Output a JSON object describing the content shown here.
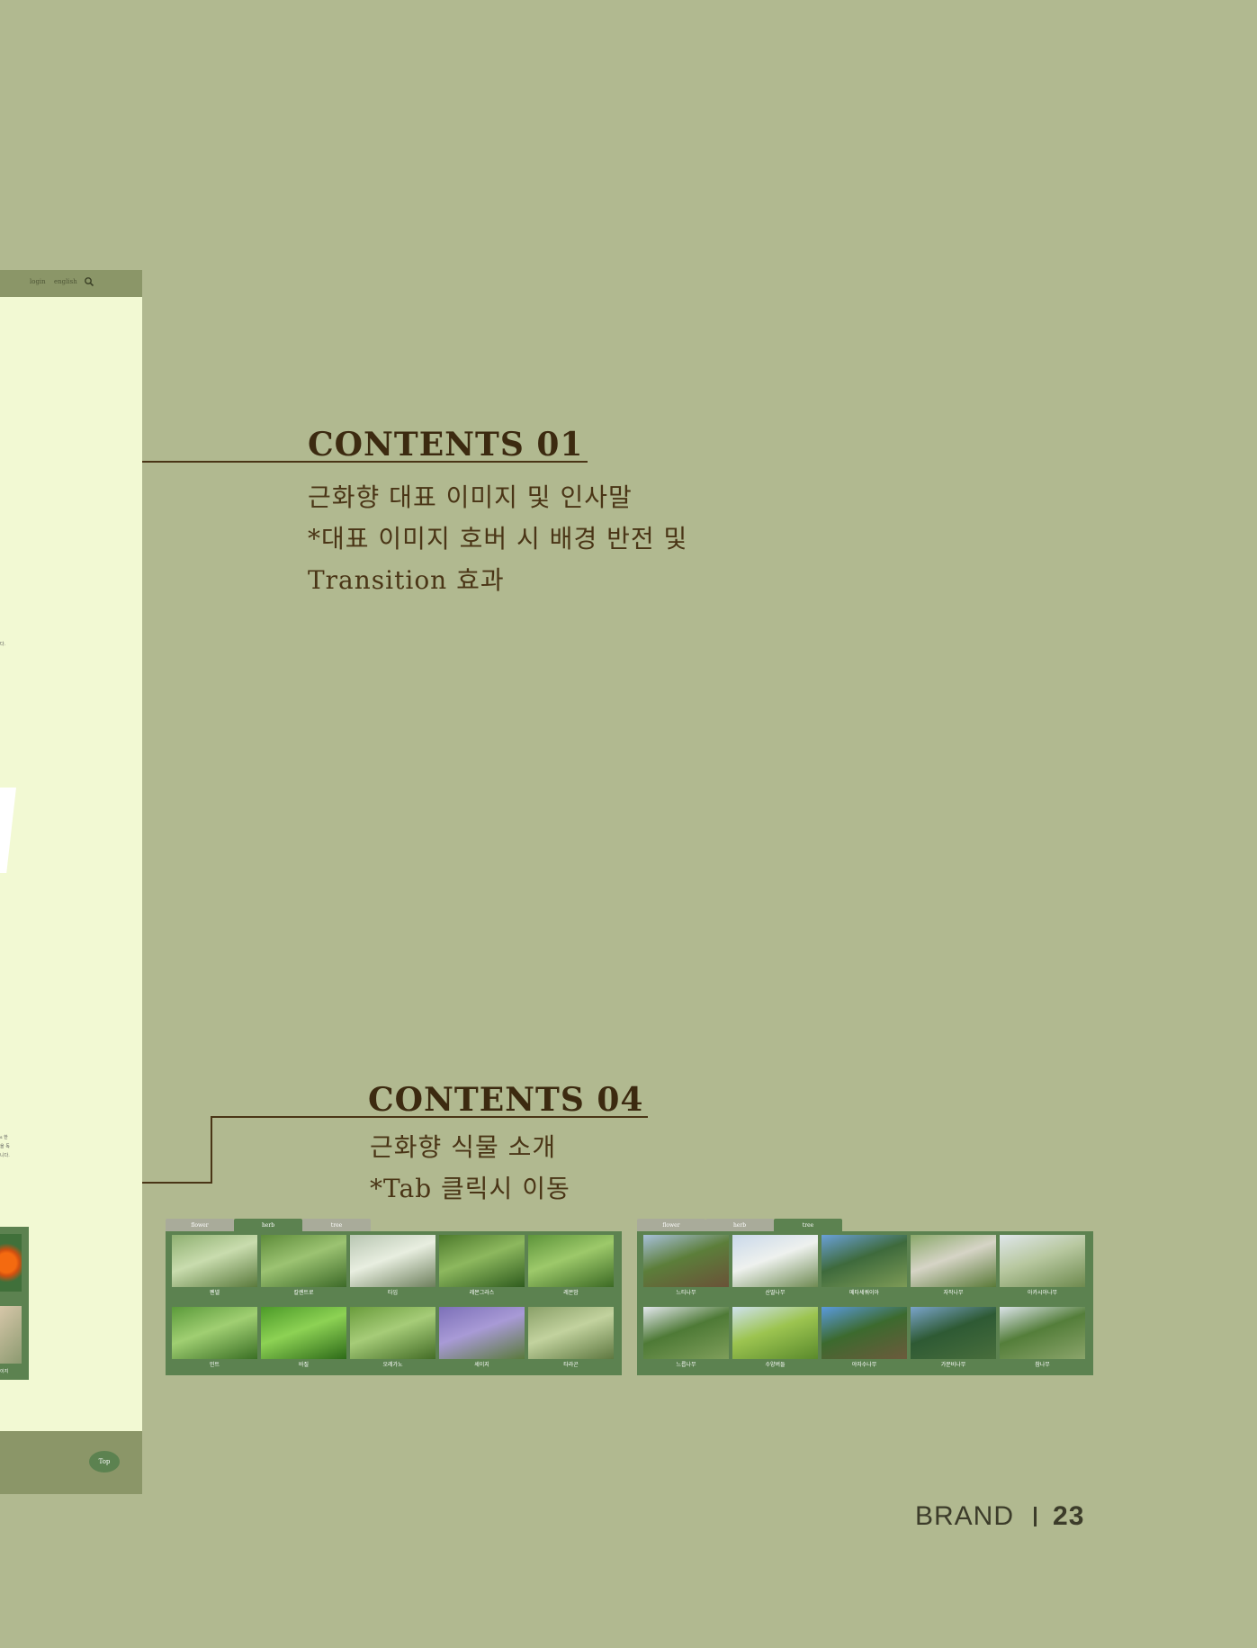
{
  "mockup": {
    "header_links": [
      "login",
      "english"
    ],
    "tiny_text_1": "다.",
    "tiny_text_2": [
      "s 한",
      "을 독",
      "니다."
    ],
    "thumb_caption": "이지",
    "top_button": "Top"
  },
  "contents_01": {
    "title": "CONTENTS 01",
    "lines": [
      "근화향 대표 이미지 및 인사말",
      "*대표 이미지 호버 시  배경 반전 및",
      "Transition 효과"
    ]
  },
  "contents_04": {
    "title": "CONTENTS 04",
    "lines": [
      "근화향 식물 소개",
      "*Tab 클릭시 이동"
    ]
  },
  "herb_panel": {
    "tabs": [
      "flower",
      "herb",
      "tree"
    ],
    "active_tab": "herb",
    "items": [
      {
        "label": "펜넬",
        "colors": [
          "#8fb071",
          "#c9dcae",
          "#5a7a3c"
        ]
      },
      {
        "label": "칼렌트로",
        "colors": [
          "#5e8c3a",
          "#9cc372",
          "#3d6a28"
        ]
      },
      {
        "label": "타임",
        "colors": [
          "#b8c6b2",
          "#e8eee0",
          "#6d7f5c"
        ]
      },
      {
        "label": "레몬그라스",
        "colors": [
          "#4d7a2c",
          "#8db85e",
          "#2f5c1e"
        ]
      },
      {
        "label": "레몬밤",
        "colors": [
          "#5d943a",
          "#9dc96a",
          "#3c6a24"
        ]
      },
      {
        "label": "민트",
        "colors": [
          "#5b9a3a",
          "#a0cf72",
          "#3a6f24"
        ]
      },
      {
        "label": "바질",
        "colors": [
          "#4c9a28",
          "#8dd254",
          "#2d6a18"
        ]
      },
      {
        "label": "오레가노",
        "colors": [
          "#6a9c3c",
          "#a6cc78",
          "#436c26"
        ]
      },
      {
        "label": "세이지",
        "colors": [
          "#7c70b8",
          "#a89ad6",
          "#5a7a3c"
        ]
      },
      {
        "label": "타라곤",
        "colors": [
          "#8aa068",
          "#c2d29e",
          "#5e7840"
        ]
      }
    ]
  },
  "tree_panel": {
    "tabs": [
      "flower",
      "herb",
      "tree"
    ],
    "active_tab": "tree",
    "items": [
      {
        "label": "느티나무",
        "colors": [
          "#a7c0da",
          "#5c7e3a",
          "#6a5238"
        ]
      },
      {
        "label": "산딸나무",
        "colors": [
          "#c9d8ea",
          "#eef1ee",
          "#6e8a52"
        ]
      },
      {
        "label": "메타세쿼이아",
        "colors": [
          "#6aa0d8",
          "#3e6a3c",
          "#7c9a56"
        ]
      },
      {
        "label": "자작나무",
        "colors": [
          "#8aa86a",
          "#d6d4c6",
          "#5a7a38"
        ]
      },
      {
        "label": "아카시아나무",
        "colors": [
          "#dfe6ea",
          "#b8c8a0",
          "#6e8a4e"
        ]
      },
      {
        "label": "느릅나무",
        "colors": [
          "#e4e8ee",
          "#4e7a36",
          "#7e9e5a"
        ]
      },
      {
        "label": "수양버들",
        "colors": [
          "#cfe2ee",
          "#9cc450",
          "#5a8a2c"
        ]
      },
      {
        "label": "야자수나무",
        "colors": [
          "#5a9ade",
          "#3c6a2e",
          "#6c5a3c"
        ]
      },
      {
        "label": "가문비나무",
        "colors": [
          "#7aa4cc",
          "#2e5a34",
          "#486e3c"
        ]
      },
      {
        "label": "참나무",
        "colors": [
          "#dce4ea",
          "#547e3a",
          "#8aa46a"
        ]
      }
    ]
  },
  "footer": {
    "brand": "BRAND",
    "page_number": "23"
  }
}
